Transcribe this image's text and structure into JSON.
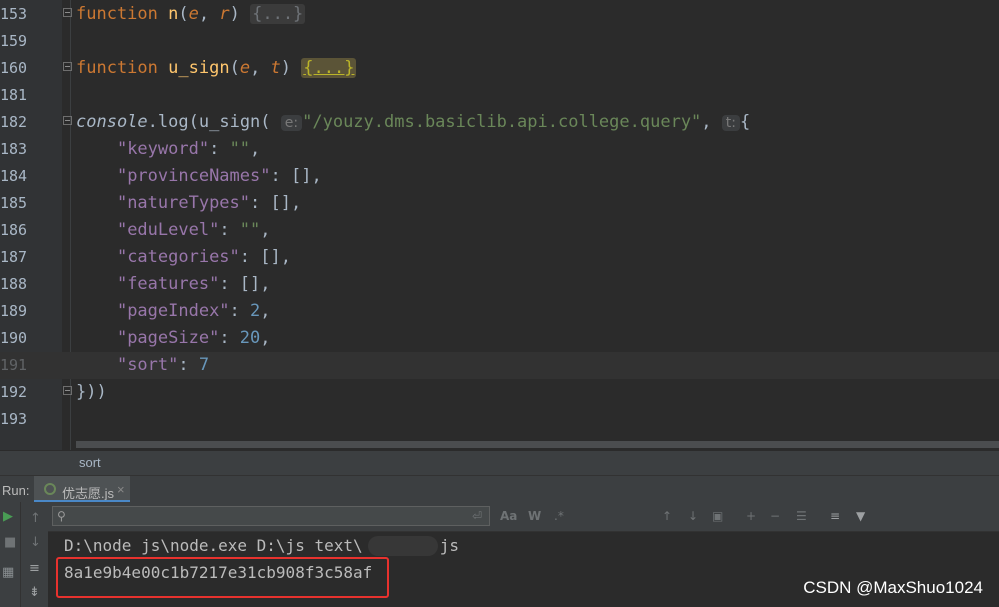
{
  "editor": {
    "lines": [
      {
        "no": "153",
        "html_kind": "fn_n"
      },
      {
        "no": "159"
      },
      {
        "no": "160",
        "html_kind": "fn_u"
      },
      {
        "no": "181"
      },
      {
        "no": "182"
      },
      {
        "no": "183"
      },
      {
        "no": "184"
      },
      {
        "no": "185"
      },
      {
        "no": "186"
      },
      {
        "no": "187"
      },
      {
        "no": "188"
      },
      {
        "no": "189"
      },
      {
        "no": "190"
      },
      {
        "no": "191"
      },
      {
        "no": "192"
      },
      {
        "no": "193"
      }
    ],
    "keyword_function": "function",
    "fn1_name": "n",
    "fn1_p1": "e",
    "fn1_p2": "r",
    "fn2_name": "u_sign",
    "fn2_p1": "e",
    "fn2_p2": "t",
    "folded": "{...}",
    "console_obj": "console",
    "console_log": "log",
    "call_fn": "u_sign",
    "hint_e": "e:",
    "hint_t": "t:",
    "call_string": "\"/youzy.dms.basiclib.api.college.query\"",
    "keys": {
      "keyword": "\"keyword\"",
      "provinceNames": "\"provinceNames\"",
      "natureTypes": "\"natureTypes\"",
      "eduLevel": "\"eduLevel\"",
      "categories": "\"categories\"",
      "features": "\"features\"",
      "pageIndex": "\"pageIndex\"",
      "pageSize": "\"pageSize\"",
      "sort": "\"sort\""
    },
    "values": {
      "keyword": "\"\"",
      "provinceNames": "[]",
      "natureTypes": "[]",
      "eduLevel": "\"\"",
      "categories": "[]",
      "features": "[]",
      "pageIndex": "2",
      "pageSize": "20",
      "sort": "7"
    },
    "closing": "}))"
  },
  "breadcrumb": "sort",
  "run_panel": {
    "label": "Run:",
    "tab_name": "优志愿.js",
    "tab_close": "×"
  },
  "console": {
    "command_line": "D:\\node js\\node.exe D:\\js text\\",
    "command_suffix": "js",
    "output": "8a1e9b4e00c1b7217e31cb908f3c58af",
    "search_placeholder": ""
  },
  "watermark": "CSDN @MaxShuo1024",
  "colors": {
    "background": "#2b2b2b",
    "keyword": "#cc7832",
    "function_name": "#ffc66d",
    "string": "#6a8759",
    "property_key": "#9876aa",
    "number": "#6897bb",
    "highlight_border": "#e8322e"
  }
}
